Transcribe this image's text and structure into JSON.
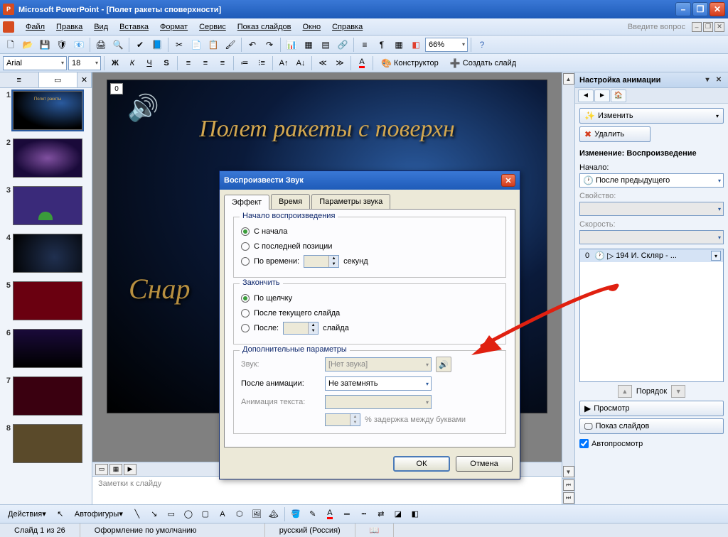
{
  "app": {
    "name": "Microsoft PowerPoint",
    "doc": "[Полет ракеты споверхности]"
  },
  "menu": [
    "Файл",
    "Правка",
    "Вид",
    "Вставка",
    "Формат",
    "Сервис",
    "Показ слайдов",
    "Окно",
    "Справка"
  ],
  "menu_ask": "Введите вопрос",
  "toolbar": {
    "zoom": "66%",
    "designer": "Конструктор",
    "new_slide": "Создать слайд"
  },
  "format": {
    "font": "Arial",
    "size": "18"
  },
  "thumbs": {
    "count": 8,
    "selected": 1
  },
  "slide": {
    "placeholder_num": "0",
    "title": "Полет ракеты с поверхн",
    "subtitle": "Снар"
  },
  "notes_placeholder": "Заметки к слайду",
  "taskpane": {
    "title": "Настройка анимации",
    "change": "Изменить",
    "delete": "Удалить",
    "heading": "Изменение: Воспроизведение",
    "start_label": "Начало:",
    "start_value": "После предыдущего",
    "property_label": "Свойство:",
    "speed_label": "Скорость:",
    "effect": {
      "order": "0",
      "name": "194 И. Скляр - ..."
    },
    "order_label": "Порядок",
    "preview": "Просмотр",
    "slideshow": "Показ слайдов",
    "autopreview": "Автопросмотр"
  },
  "dialog": {
    "title": "Воспроизвести Звук",
    "tabs": [
      "Эффект",
      "Время",
      "Параметры звука"
    ],
    "active_tab": 0,
    "group1": {
      "legend": "Начало воспроизведения",
      "opt1": "С начала",
      "opt2": "С последней позиции",
      "opt3": "По времени:",
      "opt3_unit": "секунд"
    },
    "group2": {
      "legend": "Закончить",
      "opt1": "По щелчку",
      "opt2": "После текущего слайда",
      "opt3": "После:",
      "opt3_unit": "слайда"
    },
    "group3": {
      "legend": "Дополнительные параметры",
      "sound_label": "Звук:",
      "sound_value": "[Нет звука]",
      "after_label": "После анимации:",
      "after_value": "Не затемнять",
      "textanim_label": "Анимация текста:",
      "delay_label": "% задержка между буквами"
    },
    "ok": "ОК",
    "cancel": "Отмена"
  },
  "drawbar": {
    "actions": "Действия",
    "autoshapes": "Автофигуры"
  },
  "status": {
    "slide": "Слайд 1 из 26",
    "design": "Оформление по умолчанию",
    "lang": "русский (Россия)"
  }
}
